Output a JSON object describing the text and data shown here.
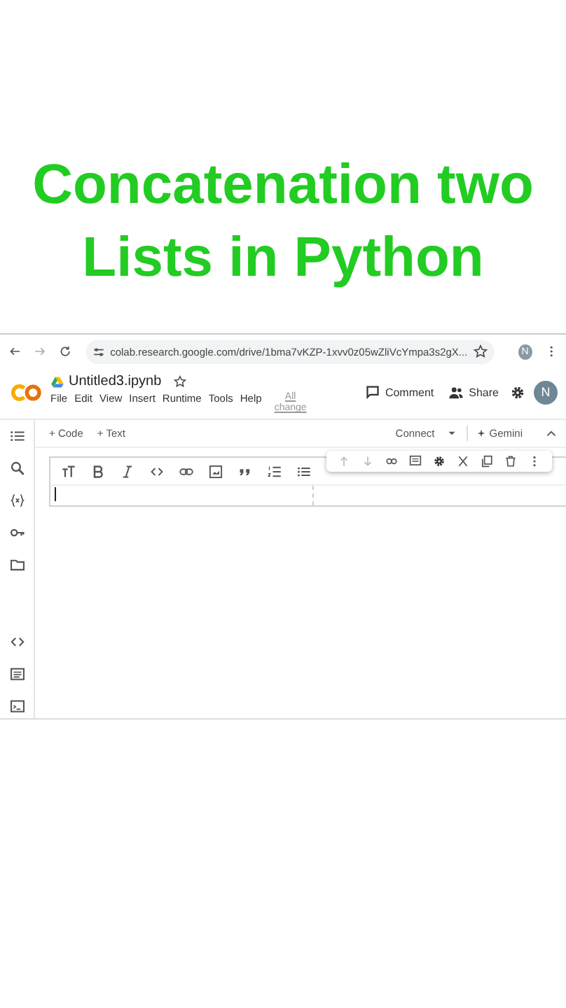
{
  "headline": [
    "Concatenation two",
    "Lists in Python"
  ],
  "browser": {
    "url": "colab.research.google.com/drive/1bma7vKZP-1xvv0z05wZliVcYmpa3s2gX...",
    "profile": "N"
  },
  "notebook": {
    "title": "Untitled3.ipynb",
    "menu": [
      "File",
      "Edit",
      "View",
      "Insert",
      "Runtime",
      "Tools",
      "Help"
    ],
    "save_status": [
      "All",
      "change"
    ],
    "comment": "Comment",
    "share": "Share",
    "avatar": "N"
  },
  "toolbar": {
    "add_code": "+ Code",
    "add_text": "+ Text",
    "connect": "Connect",
    "gemini": "Gemini"
  },
  "cell": {
    "kind": "text",
    "editing": true
  }
}
